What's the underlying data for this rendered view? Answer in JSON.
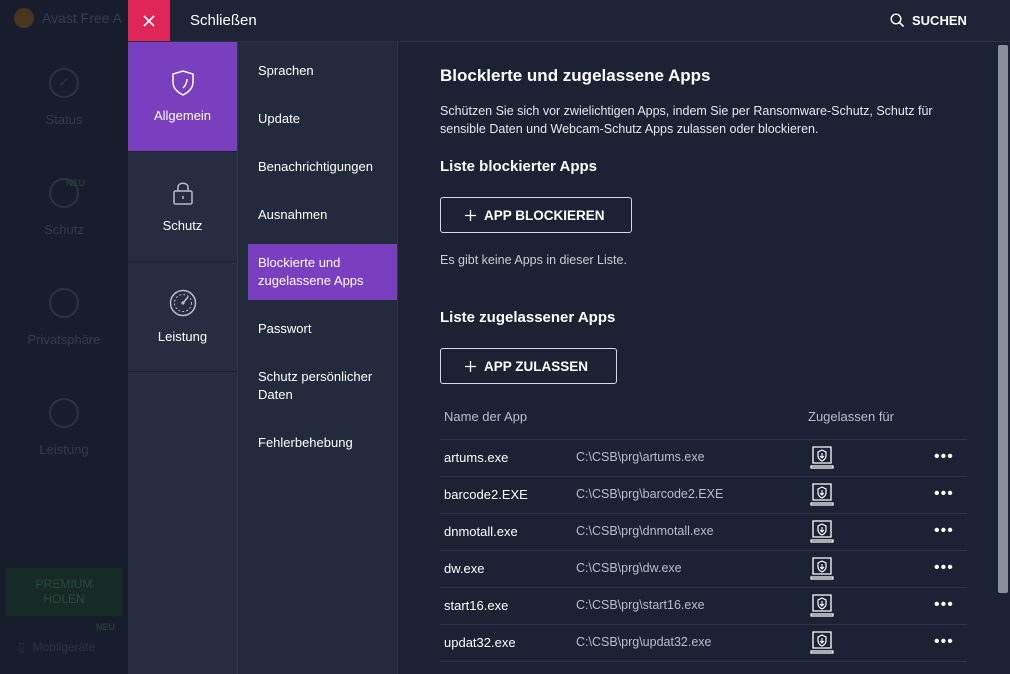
{
  "background_app": {
    "title": "Avast Free A",
    "nav": [
      {
        "label": "Status"
      },
      {
        "label": "Schutz",
        "badge": "NEU"
      },
      {
        "label": "Privatsphäre"
      },
      {
        "label": "Leistung"
      }
    ],
    "premium_label_line1": "PREMIUM",
    "premium_label_line2": "HOLEN",
    "mobile_label": "Mobilgeräte",
    "mobile_badge": "NEU"
  },
  "topbar": {
    "close_label": "Schließen",
    "search_label": "SUCHEN"
  },
  "categories": [
    {
      "label": "Allgemein",
      "icon": "shield-icon",
      "active": true
    },
    {
      "label": "Schutz",
      "icon": "lock-icon",
      "active": false
    },
    {
      "label": "Leistung",
      "icon": "speedometer-icon",
      "active": false
    }
  ],
  "subnav": [
    {
      "label": "Sprachen"
    },
    {
      "label": "Update"
    },
    {
      "label": "Benachrichtigungen"
    },
    {
      "label": "Ausnahmen"
    },
    {
      "label": "Blockierte und zugelassene Apps",
      "active": true
    },
    {
      "label": "Passwort"
    },
    {
      "label": "Schutz persönlicher Daten"
    },
    {
      "label": "Fehlerbehebung"
    }
  ],
  "main": {
    "title": "Blocklerte und zugelassene Apps",
    "description": "Schützen Sie sich vor zwielichtigen Apps, indem Sie per Ransomware-Schutz, Schutz für sensible Daten und Webcam-Schutz Apps zulassen oder blockieren.",
    "blocked_heading": "Liste blockierter Apps",
    "block_button": "APP BLOCKIEREN",
    "blocked_empty": "Es gibt keine Apps in dieser Liste.",
    "allowed_heading": "Liste zugelassener Apps",
    "allow_button": "APP ZULASSEN",
    "table": {
      "col_name": "Name der App",
      "col_allowed": "Zugelassen für",
      "rows": [
        {
          "name": "artums.exe",
          "path": "C:\\CSB\\prg\\artums.exe"
        },
        {
          "name": "barcode2.EXE",
          "path": "C:\\CSB\\prg\\barcode2.EXE"
        },
        {
          "name": "dnmotall.exe",
          "path": "C:\\CSB\\prg\\dnmotall.exe"
        },
        {
          "name": "dw.exe",
          "path": "C:\\CSB\\prg\\dw.exe"
        },
        {
          "name": "start16.exe",
          "path": "C:\\CSB\\prg\\start16.exe"
        },
        {
          "name": "updat32.exe",
          "path": "C:\\CSB\\prg\\updat32.exe"
        }
      ]
    },
    "more_glyph": "•••"
  },
  "colors": {
    "accent": "#7a3fbf",
    "close": "#e02658",
    "background": "#1c2233"
  }
}
